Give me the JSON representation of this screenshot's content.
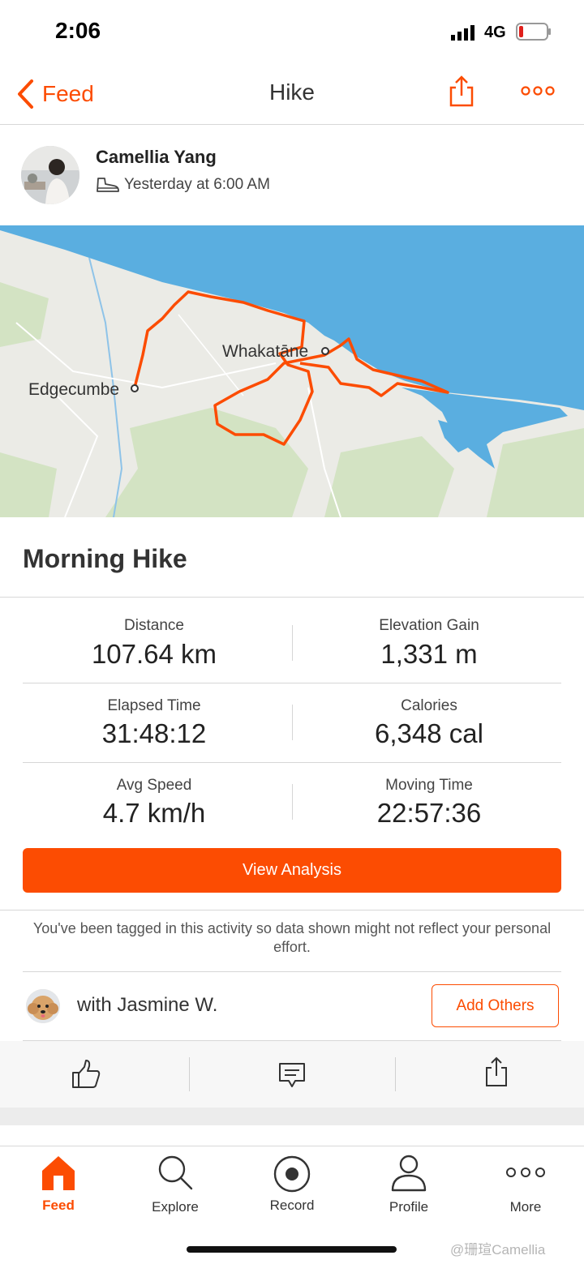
{
  "status_bar": {
    "time": "2:06",
    "network": "4G"
  },
  "nav": {
    "back_label": "Feed",
    "title": "Hike"
  },
  "post": {
    "author": "Camellia Yang",
    "timestamp": "Yesterday at 6:00 AM"
  },
  "map": {
    "labels": {
      "town1": "Whakatāne",
      "town2": "Edgecumbe"
    },
    "colors": {
      "sea": "#5aaee0",
      "land": "#ebebe6",
      "park": "#d3e3c3",
      "route": "#fc4c02"
    }
  },
  "activity": {
    "title": "Morning Hike",
    "stats": [
      {
        "label": "Distance",
        "value": "107.64 km"
      },
      {
        "label": "Elevation Gain",
        "value": "1,331 m"
      },
      {
        "label": "Elapsed Time",
        "value": "31:48:12"
      },
      {
        "label": "Calories",
        "value": "6,348 cal"
      },
      {
        "label": "Avg Speed",
        "value": "4.7 km/h"
      },
      {
        "label": "Moving Time",
        "value": "22:57:36"
      }
    ],
    "view_analysis_label": "View Analysis",
    "tag_notice": "You've been tagged in this activity so data shown might not reflect your personal effort.",
    "with_text": "with Jasmine W.",
    "add_others_label": "Add Others"
  },
  "tab_bar": {
    "items": [
      {
        "label": "Feed",
        "icon": "home-icon",
        "active": true
      },
      {
        "label": "Explore",
        "icon": "search-icon",
        "active": false
      },
      {
        "label": "Record",
        "icon": "record-icon",
        "active": false
      },
      {
        "label": "Profile",
        "icon": "profile-icon",
        "active": false
      },
      {
        "label": "More",
        "icon": "more-icon",
        "active": false
      }
    ]
  },
  "watermark": "@珊瑄Camellia",
  "colors": {
    "accent": "#fc4c02"
  }
}
